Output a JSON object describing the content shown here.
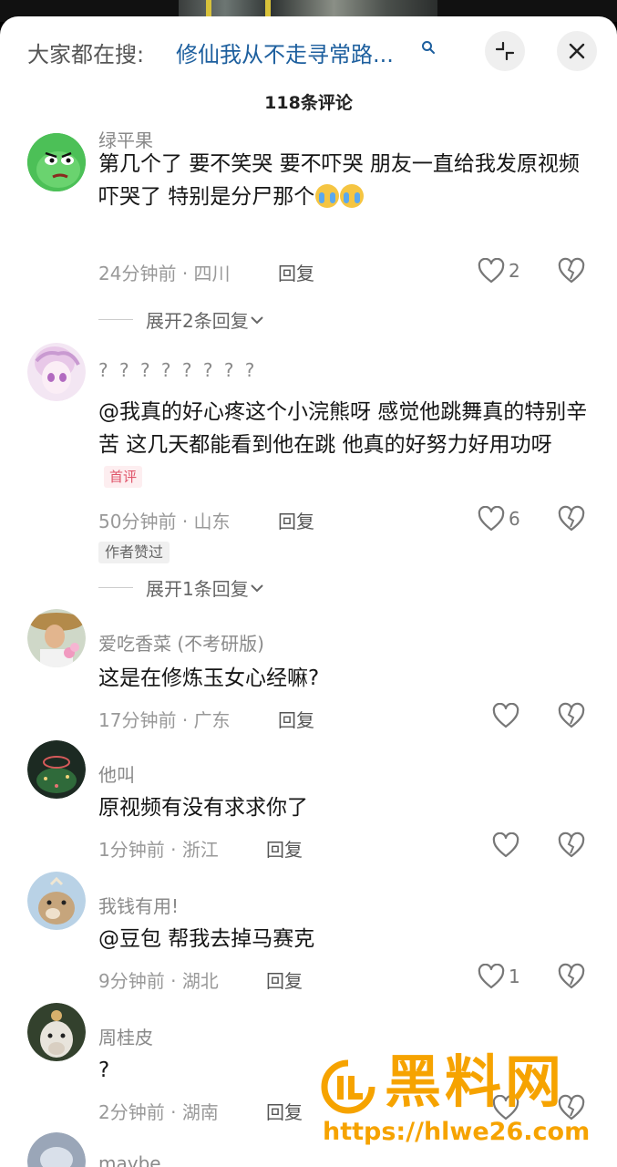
{
  "search": {
    "prefix": "大家都在搜:",
    "query": "修仙我从不走寻常路..."
  },
  "header": {
    "comment_count": "118条评论"
  },
  "comments": [
    {
      "username": "绿平果",
      "text": "第几个了 要不笑哭 要不吓哭 朋友一直给我发原视频吓哭了 特别是分尸那个",
      "emoji": [
        "loudly-crying-face",
        "loudly-crying-face"
      ],
      "time": "24分钟前",
      "location": "四川",
      "reply_label": "回复",
      "likes": "2",
      "expand_label": "展开2条回复"
    },
    {
      "username": "? ? ? ? ? ? ? ?",
      "text": "@我真的好心疼这个小浣熊呀 感觉他跳舞真的特别辛苦  这几天都能看到他在跳 他真的好努力好用功呀",
      "first_badge": "首评",
      "time": "50分钟前",
      "location": "山东",
      "reply_label": "回复",
      "likes": "6",
      "author_badge": "作者赞过",
      "expand_label": "展开1条回复"
    },
    {
      "username": "爱吃香菜 (不考研版)",
      "text": "这是在修炼玉女心经嘛?",
      "time": "17分钟前",
      "location": "广东",
      "reply_label": "回复",
      "likes": ""
    },
    {
      "username": "他叫",
      "text": "原视频有没有求求你了",
      "time": "1分钟前",
      "location": "浙江",
      "reply_label": "回复",
      "likes": ""
    },
    {
      "username": "我钱有用!",
      "text": "@豆包 帮我去掉马赛克",
      "time": "9分钟前",
      "location": "湖北",
      "reply_label": "回复",
      "likes": "1"
    },
    {
      "username": "周桂皮",
      "text": "?",
      "time": "2分钟前",
      "location": "湖南",
      "reply_label": "回复",
      "likes": ""
    },
    {
      "username": "maybe"
    }
  ],
  "meta_separator": "·",
  "watermark": {
    "title": "黑料网",
    "url": "https://hlwe26.com"
  },
  "colors": {
    "link": "#1d5f9e",
    "first_badge": "#e0546a",
    "watermark": "#f6a300"
  }
}
